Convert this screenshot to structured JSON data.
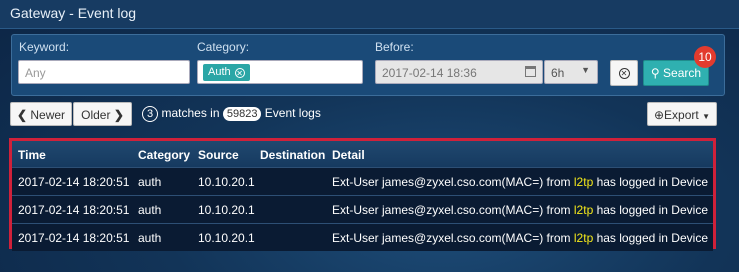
{
  "window": {
    "title": "Gateway - Event log"
  },
  "filters": {
    "keyword_label": "Keyword:",
    "keyword_placeholder": "Any",
    "category_label": "Category:",
    "category_tag": "Auth",
    "before_label": "Before:",
    "before_value": "2017-02-14 18:36",
    "range_value": "6h",
    "search_label": "Search",
    "search_badge": "10"
  },
  "toolbar": {
    "newer_label": "Newer",
    "older_label": "Older",
    "match_count": "3",
    "matches_in_text": "matches in",
    "total_count": "59823",
    "event_logs_text": "Event logs",
    "export_label": "Export"
  },
  "table": {
    "columns": [
      "Time",
      "Category",
      "Source",
      "Destination",
      "Detail"
    ],
    "rows": [
      {
        "time": "2017-02-14 18:20:51",
        "category": "auth",
        "source": "10.10.20.1",
        "destination": "",
        "detail_pre": "Ext-User james@zyxel.cso.com(MAC=) from ",
        "detail_hl": "l2tp",
        "detail_post": " has logged in Device"
      },
      {
        "time": "2017-02-14 18:20:51",
        "category": "auth",
        "source": "10.10.20.1",
        "destination": "",
        "detail_pre": "Ext-User james@zyxel.cso.com(MAC=) from ",
        "detail_hl": "l2tp",
        "detail_post": " has logged in Device"
      },
      {
        "time": "2017-02-14 18:20:51",
        "category": "auth",
        "source": "10.10.20.1",
        "destination": "",
        "detail_pre": "Ext-User james@zyxel.cso.com(MAC=) from ",
        "detail_hl": "l2tp",
        "detail_post": " has logged in Device"
      }
    ]
  },
  "colors": {
    "accent_teal": "#2fb0b0",
    "badge_red": "#e23b2e",
    "highlight_yellow": "#f4e81a",
    "table_border_red": "#d0213a"
  }
}
